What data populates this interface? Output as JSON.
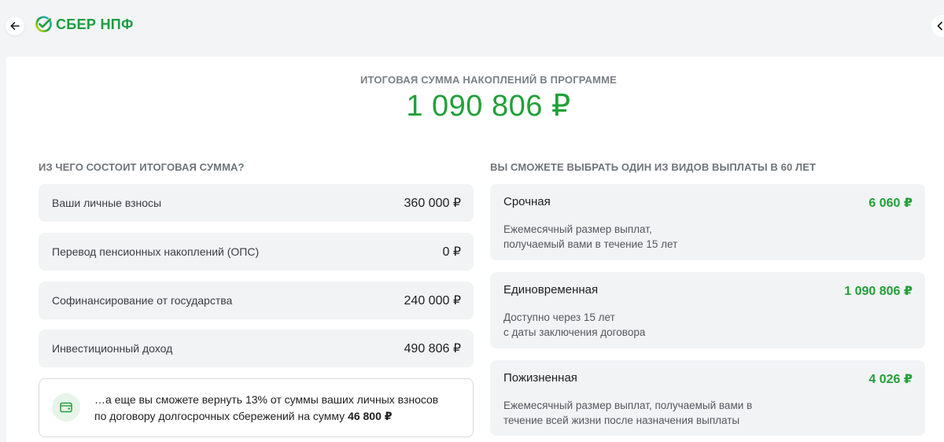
{
  "header": {
    "back_icon": "arrow-left-icon",
    "logo_icon": "sber-checkmark-logo",
    "logo_text": "СБЕР НПФ",
    "right_edge_icon": "chevron-left-icon"
  },
  "total": {
    "label": "ИТОГОВАЯ СУММА НАКОПЛЕНИЙ В ПРОГРАММЕ",
    "amount": "1 090 806 ₽"
  },
  "composition": {
    "title": "ИЗ ЧЕГО СОСТОИТ ИТОГОВАЯ СУММА?",
    "items": [
      {
        "label": "Ваши личные взносы",
        "value": "360 000 ₽"
      },
      {
        "label": "Перевод пенсионных накоплений (ОПС)",
        "value": "0 ₽"
      },
      {
        "label": "Софинансирование от государства",
        "value": "240 000 ₽"
      },
      {
        "label": "Инвестиционный доход",
        "value": "490 806 ₽"
      }
    ],
    "refund": {
      "icon": "wallet-icon",
      "line1": "…а еще вы сможете вернуть 13% от суммы ваших личных взносов",
      "line2_prefix": "по договору долгосрочных сбережений на сумму",
      "line2_amount": "46 800 ₽"
    }
  },
  "payouts": {
    "title": "ВЫ СМОЖЕТЕ ВЫБРАТЬ ОДИН ИЗ ВИДОВ ВЫПЛАТЫ В 60 ЛЕТ",
    "items": [
      {
        "name": "Срочная",
        "value": "6 060 ₽",
        "desc_line1": "Ежемесячный размер выплат,",
        "desc_line2": "получаемый вами в течение 15 лет"
      },
      {
        "name": "Единовременная",
        "value": "1 090 806 ₽",
        "desc_line1": "Доступно через 15 лет",
        "desc_line2": "с даты заключения договора"
      },
      {
        "name": "Пожизненная",
        "value": "4 026 ₽",
        "desc_line1": "Ежемесячный размер выплат, получаемый вами в",
        "desc_line2": "течение всей жизни после назначения выплаты"
      }
    ]
  },
  "colors": {
    "brand_green": "#21a038",
    "page_background": "#f2f4f6",
    "item_background": "#f2f3f5"
  }
}
